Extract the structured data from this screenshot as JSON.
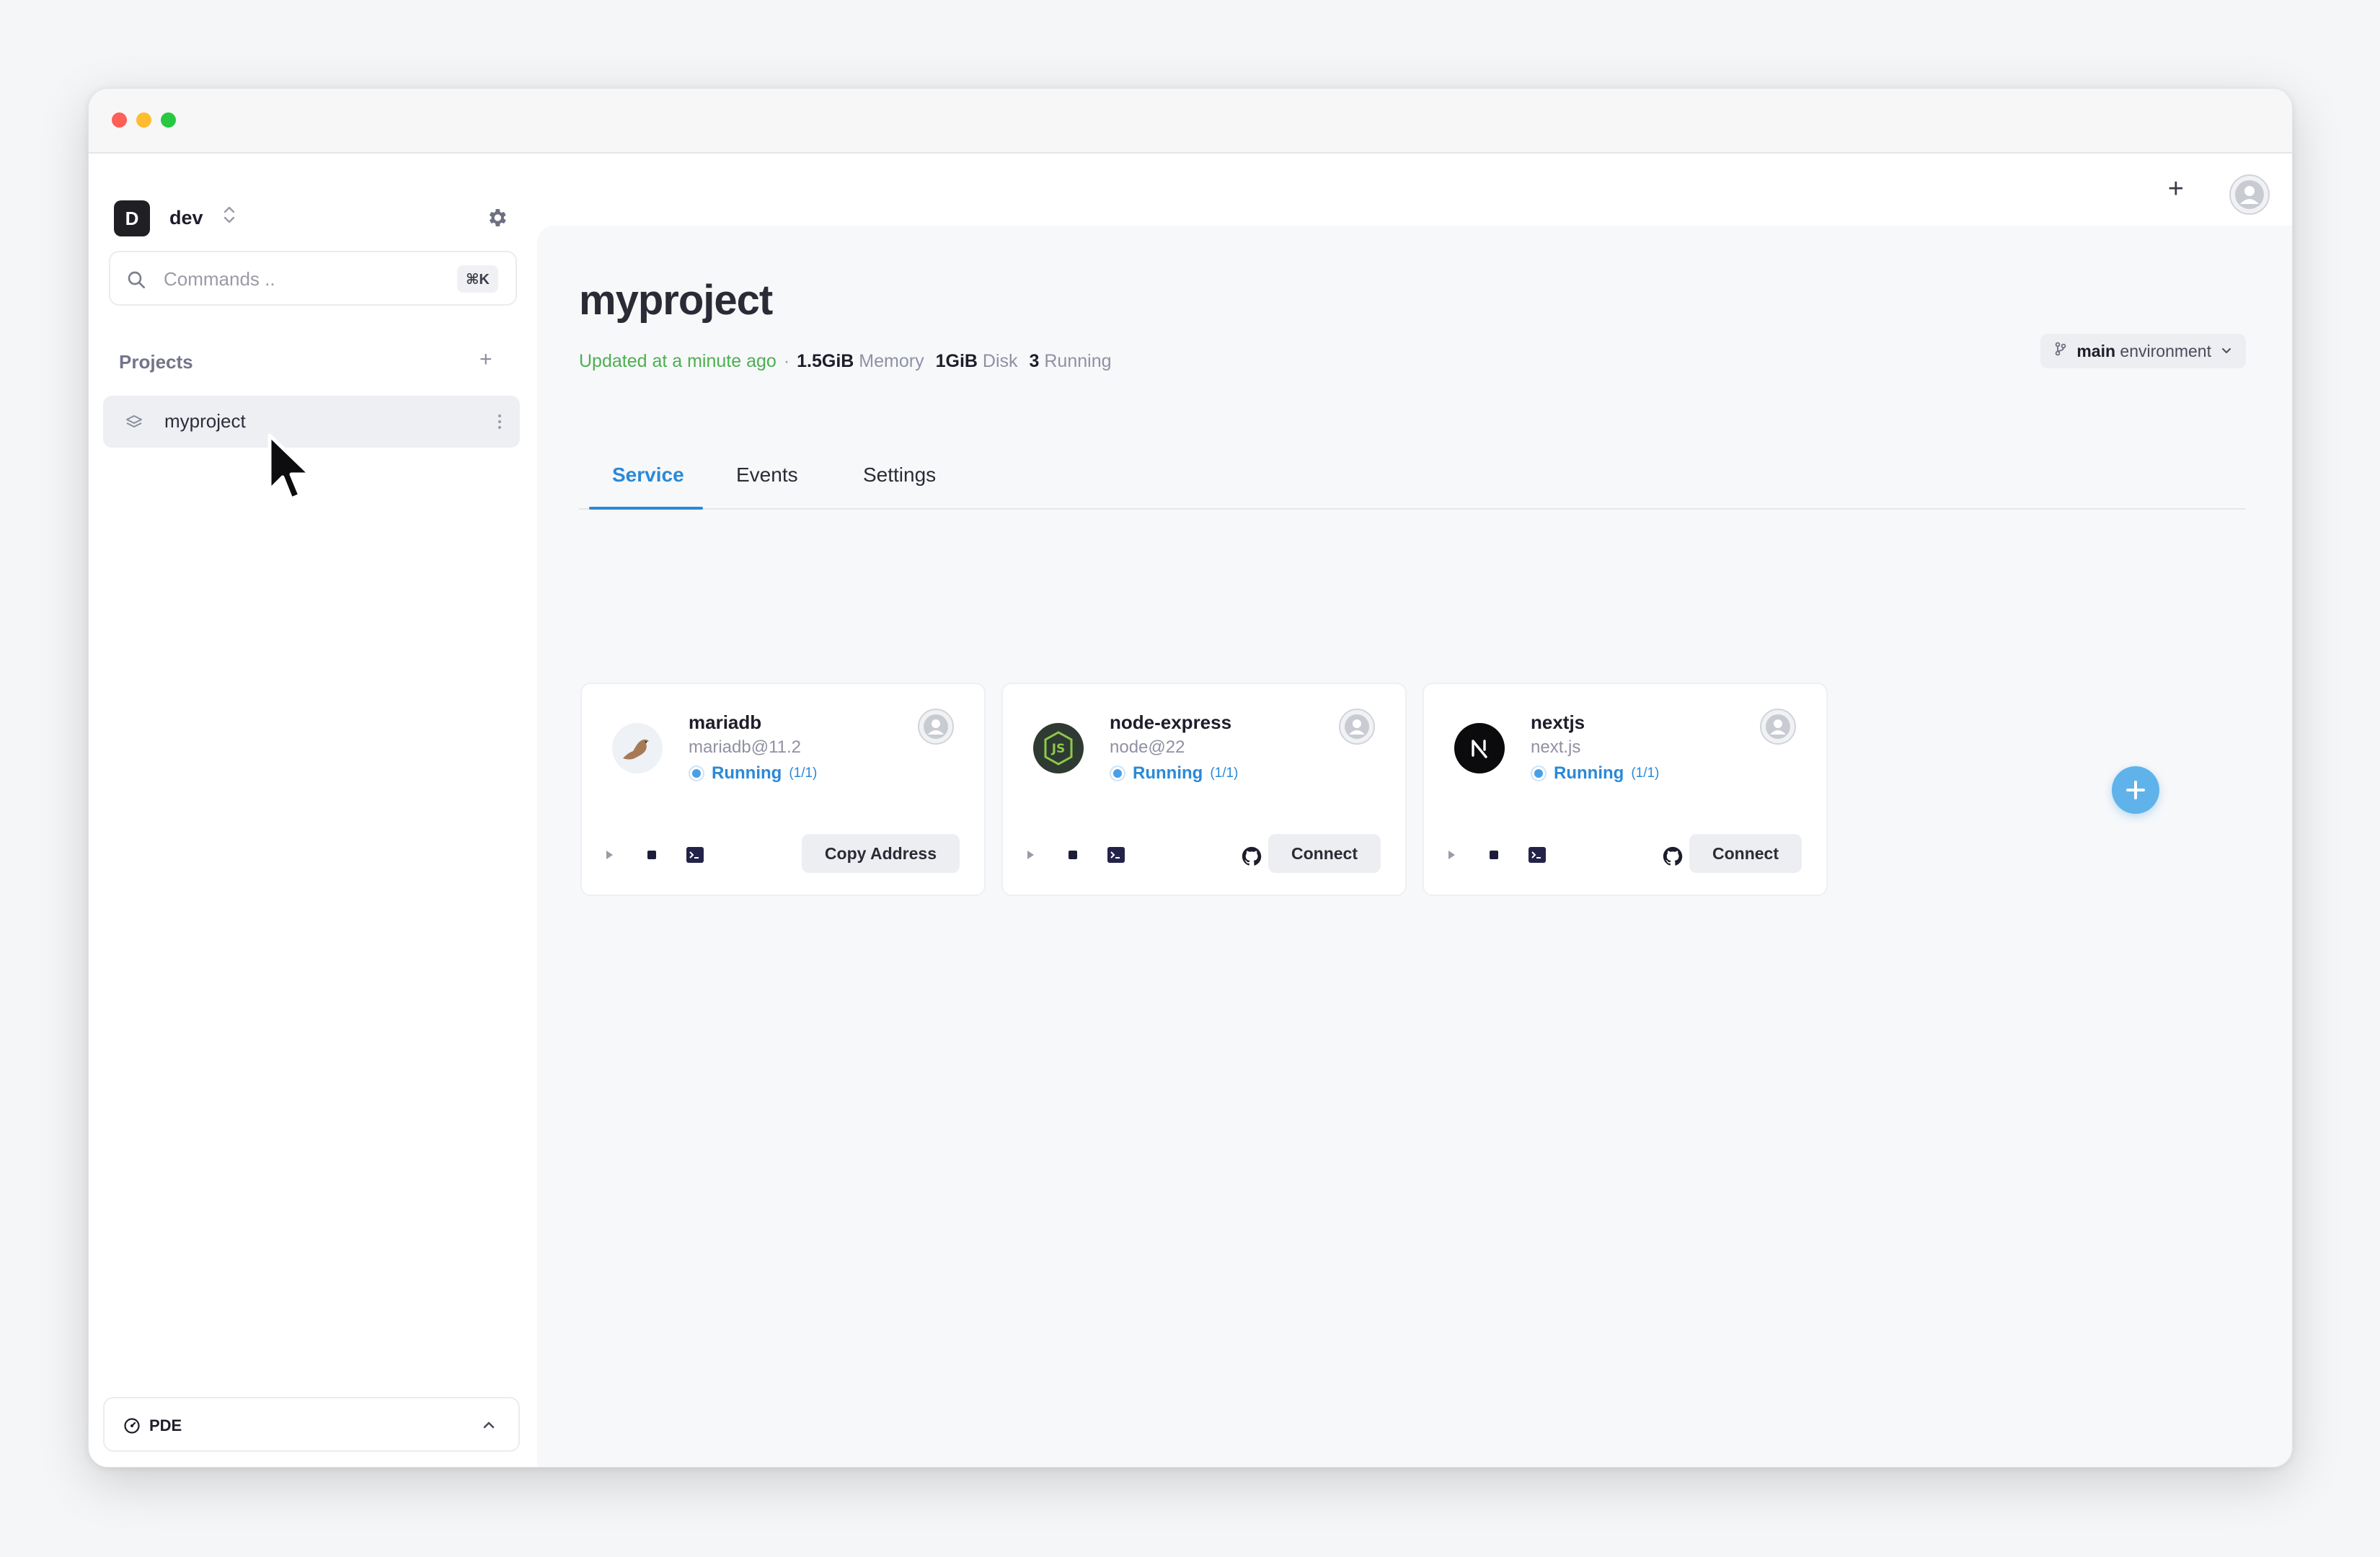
{
  "workspace": {
    "badge": "D",
    "name": "dev"
  },
  "search": {
    "placeholder": "Commands ..",
    "shortcut": "⌘K"
  },
  "sidebar": {
    "section_label": "Projects",
    "projects": [
      {
        "name": "myproject"
      }
    ],
    "footer": {
      "label": "PDE"
    }
  },
  "page": {
    "title": "myproject",
    "updated": "Updated at a minute ago",
    "separator": "·",
    "memory_value": "1.5GiB",
    "memory_label": "Memory",
    "disk_value": "1GiB",
    "disk_label": "Disk",
    "running_value": "3",
    "running_label": "Running",
    "environment": {
      "name": "main",
      "suffix": "environment"
    }
  },
  "tabs": [
    {
      "label": "Service",
      "active": true
    },
    {
      "label": "Events",
      "active": false
    },
    {
      "label": "Settings",
      "active": false
    }
  ],
  "services": [
    {
      "name": "mariadb",
      "image": "mariadb@11.2",
      "status": "Running",
      "count": "(1/1)",
      "action": "Copy Address",
      "icon": "mariadb-seal-icon",
      "github": false
    },
    {
      "name": "node-express",
      "image": "node@22",
      "status": "Running",
      "count": "(1/1)",
      "action": "Connect",
      "icon": "nodejs-icon",
      "github": true
    },
    {
      "name": "nextjs",
      "image": "next.js",
      "status": "Running",
      "count": "(1/1)",
      "action": "Connect",
      "icon": "nextjs-icon",
      "github": true
    }
  ],
  "colors": {
    "accent": "#2a89d8",
    "updated_green": "#4caf50",
    "fab": "#5fb3ea"
  }
}
